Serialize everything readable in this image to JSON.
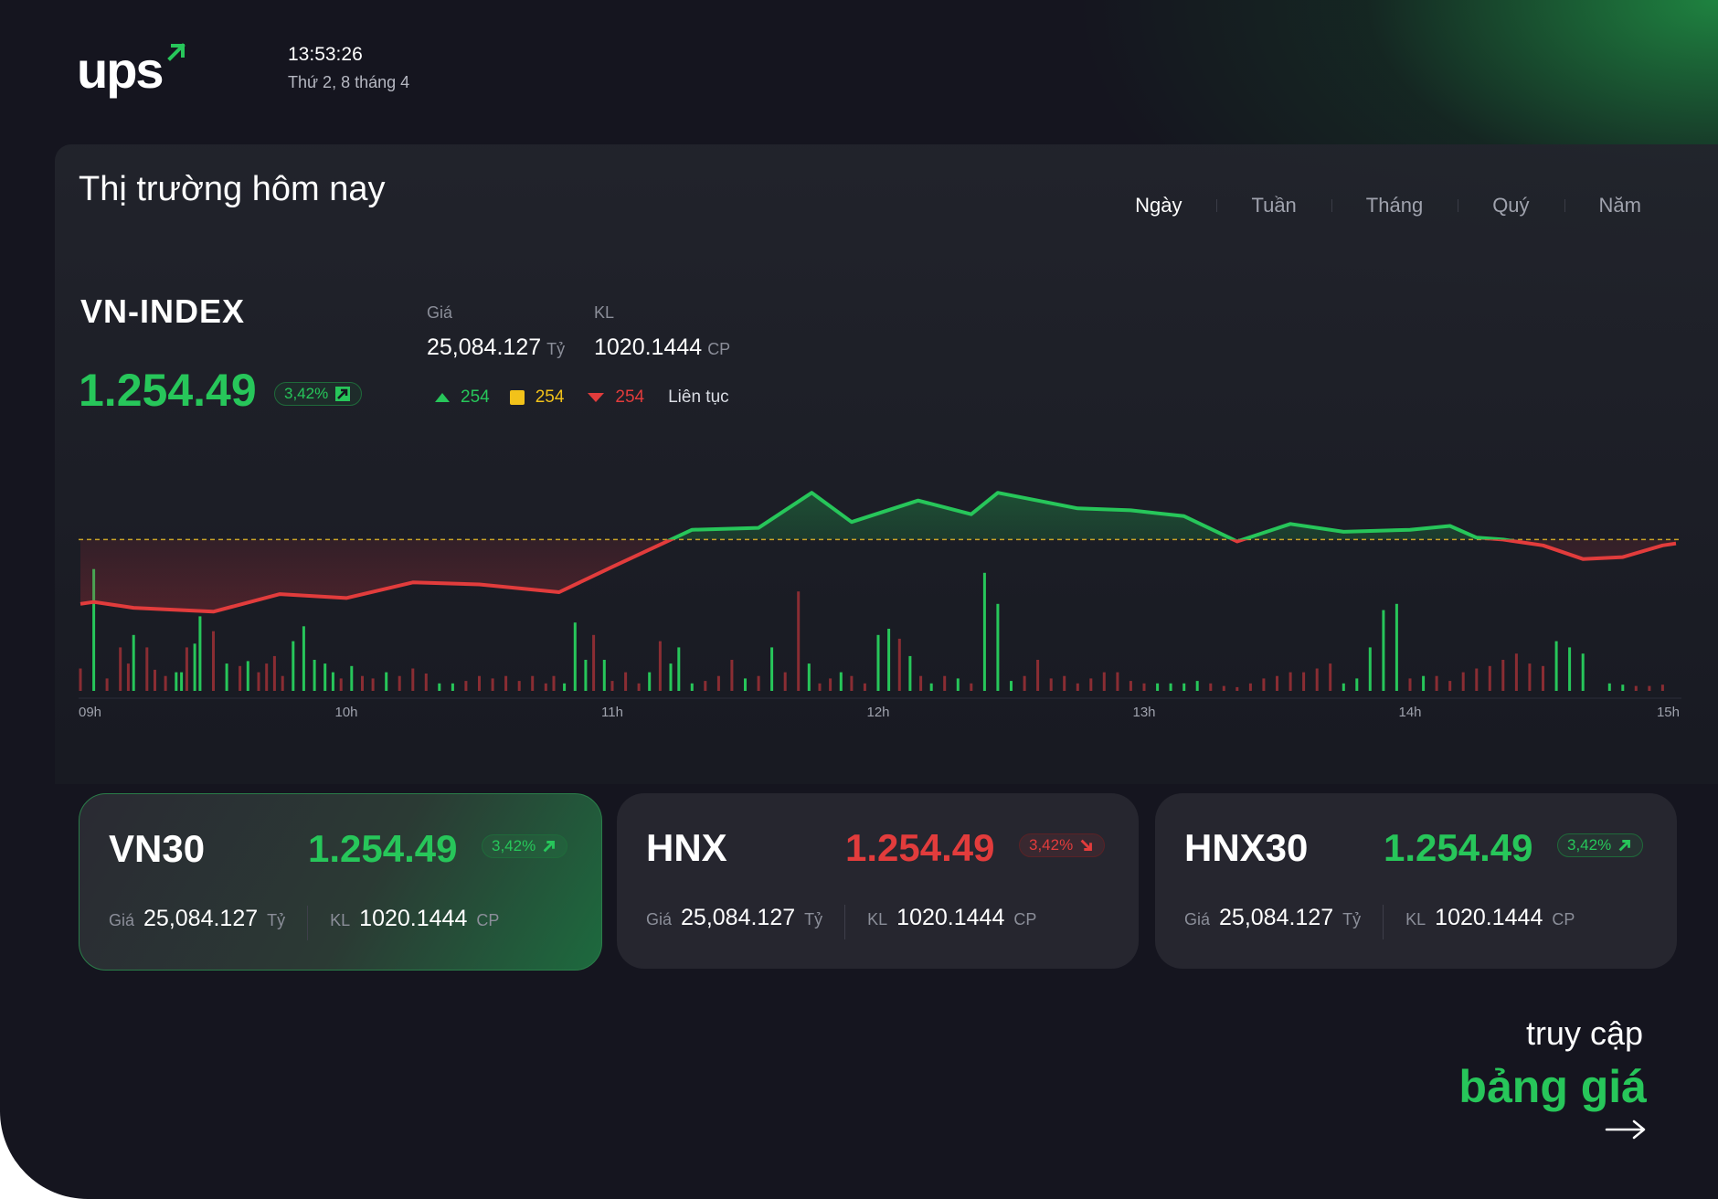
{
  "brand": {
    "logo_text": "ups",
    "accent": "#27c65a"
  },
  "header": {
    "time": "13:53:26",
    "date": "Thứ 2, 8 tháng 4"
  },
  "panel": {
    "title": "Thị trường hôm nay",
    "tabs": [
      "Ngày",
      "Tuần",
      "Tháng",
      "Quý",
      "Năm"
    ],
    "active_tab": "Ngày"
  },
  "vnindex": {
    "name": "VN-INDEX",
    "value": "1.254.49",
    "change": "3,42%",
    "trend": "up",
    "price_label": "Giá",
    "price": "25,084.127",
    "price_unit": "Tỷ",
    "volume_label": "KL",
    "volume": "1020.1444",
    "volume_unit": "CP",
    "advances": "254",
    "unchanged": "254",
    "declines": "254",
    "session": "Liên tục"
  },
  "chart_data": {
    "type": "line",
    "x_ticks": [
      "09h",
      "10h",
      "11h",
      "12h",
      "13h",
      "14h",
      "15h"
    ],
    "x": [
      9.0,
      9.05,
      9.2,
      9.5,
      9.75,
      10.0,
      10.25,
      10.5,
      10.8,
      11.0,
      11.3,
      11.55,
      11.75,
      11.9,
      12.15,
      12.35,
      12.45,
      12.75,
      12.95,
      13.15,
      13.35,
      13.55,
      13.75,
      14.0,
      14.15,
      14.25,
      14.35,
      14.5,
      14.65,
      14.8,
      14.95,
      15.0
    ],
    "values": [
      1249.4,
      1249.5,
      1249.2,
      1249.0,
      1249.9,
      1249.7,
      1250.5,
      1250.4,
      1250.0,
      1251.3,
      1253.2,
      1253.3,
      1255.1,
      1253.6,
      1254.7,
      1254.0,
      1255.1,
      1254.3,
      1254.2,
      1253.9,
      1252.6,
      1253.5,
      1253.1,
      1253.2,
      1253.4,
      1252.8,
      1252.7,
      1252.4,
      1251.7,
      1251.8,
      1252.4,
      1252.5
    ],
    "reference": 1252.7,
    "ylim": [
      1248.5,
      1256.0
    ],
    "volume_bars": [
      {
        "x": 9.0,
        "h": 0.18,
        "c": "down"
      },
      {
        "x": 9.05,
        "h": 0.98,
        "c": "up"
      },
      {
        "x": 9.1,
        "h": 0.1,
        "c": "down"
      },
      {
        "x": 9.15,
        "h": 0.35,
        "c": "down"
      },
      {
        "x": 9.18,
        "h": 0.22,
        "c": "down"
      },
      {
        "x": 9.2,
        "h": 0.45,
        "c": "up"
      },
      {
        "x": 9.25,
        "h": 0.35,
        "c": "down"
      },
      {
        "x": 9.28,
        "h": 0.17,
        "c": "down"
      },
      {
        "x": 9.32,
        "h": 0.12,
        "c": "down"
      },
      {
        "x": 9.36,
        "h": 0.15,
        "c": "up"
      },
      {
        "x": 9.38,
        "h": 0.15,
        "c": "up"
      },
      {
        "x": 9.4,
        "h": 0.35,
        "c": "down"
      },
      {
        "x": 9.43,
        "h": 0.38,
        "c": "up"
      },
      {
        "x": 9.45,
        "h": 0.6,
        "c": "up"
      },
      {
        "x": 9.5,
        "h": 0.48,
        "c": "down"
      },
      {
        "x": 9.55,
        "h": 0.22,
        "c": "up"
      },
      {
        "x": 9.6,
        "h": 0.2,
        "c": "down"
      },
      {
        "x": 9.63,
        "h": 0.24,
        "c": "up"
      },
      {
        "x": 9.67,
        "h": 0.15,
        "c": "down"
      },
      {
        "x": 9.7,
        "h": 0.22,
        "c": "down"
      },
      {
        "x": 9.73,
        "h": 0.28,
        "c": "down"
      },
      {
        "x": 9.76,
        "h": 0.12,
        "c": "down"
      },
      {
        "x": 9.8,
        "h": 0.4,
        "c": "up"
      },
      {
        "x": 9.84,
        "h": 0.52,
        "c": "up"
      },
      {
        "x": 9.88,
        "h": 0.25,
        "c": "up"
      },
      {
        "x": 9.92,
        "h": 0.22,
        "c": "up"
      },
      {
        "x": 9.95,
        "h": 0.15,
        "c": "up"
      },
      {
        "x": 9.98,
        "h": 0.1,
        "c": "down"
      },
      {
        "x": 10.02,
        "h": 0.2,
        "c": "up"
      },
      {
        "x": 10.06,
        "h": 0.12,
        "c": "down"
      },
      {
        "x": 10.1,
        "h": 0.1,
        "c": "down"
      },
      {
        "x": 10.15,
        "h": 0.15,
        "c": "up"
      },
      {
        "x": 10.2,
        "h": 0.12,
        "c": "down"
      },
      {
        "x": 10.25,
        "h": 0.18,
        "c": "down"
      },
      {
        "x": 10.3,
        "h": 0.14,
        "c": "down"
      },
      {
        "x": 10.35,
        "h": 0.06,
        "c": "up"
      },
      {
        "x": 10.4,
        "h": 0.06,
        "c": "up"
      },
      {
        "x": 10.45,
        "h": 0.08,
        "c": "down"
      },
      {
        "x": 10.5,
        "h": 0.12,
        "c": "down"
      },
      {
        "x": 10.55,
        "h": 0.1,
        "c": "down"
      },
      {
        "x": 10.6,
        "h": 0.12,
        "c": "down"
      },
      {
        "x": 10.65,
        "h": 0.08,
        "c": "down"
      },
      {
        "x": 10.7,
        "h": 0.12,
        "c": "down"
      },
      {
        "x": 10.75,
        "h": 0.06,
        "c": "down"
      },
      {
        "x": 10.78,
        "h": 0.12,
        "c": "down"
      },
      {
        "x": 10.82,
        "h": 0.06,
        "c": "up"
      },
      {
        "x": 10.86,
        "h": 0.55,
        "c": "up"
      },
      {
        "x": 10.9,
        "h": 0.25,
        "c": "up"
      },
      {
        "x": 10.93,
        "h": 0.45,
        "c": "down"
      },
      {
        "x": 10.97,
        "h": 0.25,
        "c": "up"
      },
      {
        "x": 11.0,
        "h": 0.08,
        "c": "down"
      },
      {
        "x": 11.05,
        "h": 0.15,
        "c": "down"
      },
      {
        "x": 11.1,
        "h": 0.06,
        "c": "down"
      },
      {
        "x": 11.14,
        "h": 0.15,
        "c": "up"
      },
      {
        "x": 11.18,
        "h": 0.4,
        "c": "down"
      },
      {
        "x": 11.22,
        "h": 0.22,
        "c": "up"
      },
      {
        "x": 11.25,
        "h": 0.35,
        "c": "up"
      },
      {
        "x": 11.3,
        "h": 0.06,
        "c": "up"
      },
      {
        "x": 11.35,
        "h": 0.08,
        "c": "down"
      },
      {
        "x": 11.4,
        "h": 0.12,
        "c": "down"
      },
      {
        "x": 11.45,
        "h": 0.25,
        "c": "down"
      },
      {
        "x": 11.5,
        "h": 0.1,
        "c": "up"
      },
      {
        "x": 11.55,
        "h": 0.12,
        "c": "down"
      },
      {
        "x": 11.6,
        "h": 0.35,
        "c": "up"
      },
      {
        "x": 11.65,
        "h": 0.15,
        "c": "down"
      },
      {
        "x": 11.7,
        "h": 0.8,
        "c": "down"
      },
      {
        "x": 11.74,
        "h": 0.22,
        "c": "up"
      },
      {
        "x": 11.78,
        "h": 0.06,
        "c": "down"
      },
      {
        "x": 11.82,
        "h": 0.1,
        "c": "down"
      },
      {
        "x": 11.86,
        "h": 0.15,
        "c": "up"
      },
      {
        "x": 11.9,
        "h": 0.12,
        "c": "down"
      },
      {
        "x": 11.95,
        "h": 0.06,
        "c": "down"
      },
      {
        "x": 12.0,
        "h": 0.45,
        "c": "up"
      },
      {
        "x": 12.04,
        "h": 0.5,
        "c": "up"
      },
      {
        "x": 12.08,
        "h": 0.42,
        "c": "down"
      },
      {
        "x": 12.12,
        "h": 0.28,
        "c": "up"
      },
      {
        "x": 12.16,
        "h": 0.12,
        "c": "down"
      },
      {
        "x": 12.2,
        "h": 0.06,
        "c": "up"
      },
      {
        "x": 12.25,
        "h": 0.12,
        "c": "down"
      },
      {
        "x": 12.3,
        "h": 0.1,
        "c": "up"
      },
      {
        "x": 12.35,
        "h": 0.06,
        "c": "down"
      },
      {
        "x": 12.4,
        "h": 0.95,
        "c": "up"
      },
      {
        "x": 12.45,
        "h": 0.7,
        "c": "up"
      },
      {
        "x": 12.5,
        "h": 0.08,
        "c": "up"
      },
      {
        "x": 12.55,
        "h": 0.12,
        "c": "down"
      },
      {
        "x": 12.6,
        "h": 0.25,
        "c": "down"
      },
      {
        "x": 12.65,
        "h": 0.1,
        "c": "down"
      },
      {
        "x": 12.7,
        "h": 0.12,
        "c": "down"
      },
      {
        "x": 12.75,
        "h": 0.06,
        "c": "down"
      },
      {
        "x": 12.8,
        "h": 0.1,
        "c": "down"
      },
      {
        "x": 12.85,
        "h": 0.15,
        "c": "down"
      },
      {
        "x": 12.9,
        "h": 0.15,
        "c": "down"
      },
      {
        "x": 12.95,
        "h": 0.08,
        "c": "down"
      },
      {
        "x": 13.0,
        "h": 0.06,
        "c": "down"
      },
      {
        "x": 13.05,
        "h": 0.06,
        "c": "up"
      },
      {
        "x": 13.1,
        "h": 0.06,
        "c": "up"
      },
      {
        "x": 13.15,
        "h": 0.06,
        "c": "up"
      },
      {
        "x": 13.2,
        "h": 0.08,
        "c": "up"
      },
      {
        "x": 13.25,
        "h": 0.06,
        "c": "down"
      },
      {
        "x": 13.3,
        "h": 0.04,
        "c": "down"
      },
      {
        "x": 13.35,
        "h": 0.03,
        "c": "down"
      },
      {
        "x": 13.4,
        "h": 0.06,
        "c": "down"
      },
      {
        "x": 13.45,
        "h": 0.1,
        "c": "down"
      },
      {
        "x": 13.5,
        "h": 0.12,
        "c": "down"
      },
      {
        "x": 13.55,
        "h": 0.15,
        "c": "down"
      },
      {
        "x": 13.6,
        "h": 0.15,
        "c": "down"
      },
      {
        "x": 13.65,
        "h": 0.18,
        "c": "down"
      },
      {
        "x": 13.7,
        "h": 0.22,
        "c": "down"
      },
      {
        "x": 13.75,
        "h": 0.06,
        "c": "up"
      },
      {
        "x": 13.8,
        "h": 0.1,
        "c": "up"
      },
      {
        "x": 13.85,
        "h": 0.35,
        "c": "up"
      },
      {
        "x": 13.9,
        "h": 0.65,
        "c": "up"
      },
      {
        "x": 13.95,
        "h": 0.7,
        "c": "up"
      },
      {
        "x": 14.0,
        "h": 0.1,
        "c": "down"
      },
      {
        "x": 14.05,
        "h": 0.12,
        "c": "up"
      },
      {
        "x": 14.1,
        "h": 0.12,
        "c": "down"
      },
      {
        "x": 14.15,
        "h": 0.08,
        "c": "down"
      },
      {
        "x": 14.2,
        "h": 0.15,
        "c": "down"
      },
      {
        "x": 14.25,
        "h": 0.18,
        "c": "down"
      },
      {
        "x": 14.3,
        "h": 0.2,
        "c": "down"
      },
      {
        "x": 14.35,
        "h": 0.25,
        "c": "down"
      },
      {
        "x": 14.4,
        "h": 0.3,
        "c": "down"
      },
      {
        "x": 14.45,
        "h": 0.22,
        "c": "down"
      },
      {
        "x": 14.5,
        "h": 0.2,
        "c": "down"
      },
      {
        "x": 14.55,
        "h": 0.4,
        "c": "up"
      },
      {
        "x": 14.6,
        "h": 0.35,
        "c": "up"
      },
      {
        "x": 14.65,
        "h": 0.3,
        "c": "up"
      },
      {
        "x": 14.75,
        "h": 0.06,
        "c": "up"
      },
      {
        "x": 14.8,
        "h": 0.05,
        "c": "up"
      },
      {
        "x": 14.85,
        "h": 0.04,
        "c": "down"
      },
      {
        "x": 14.9,
        "h": 0.04,
        "c": "down"
      },
      {
        "x": 14.95,
        "h": 0.05,
        "c": "down"
      }
    ]
  },
  "cards": [
    {
      "name": "VN30",
      "value": "1.254.49",
      "change": "3,42%",
      "trend": "up",
      "highlight": true,
      "price_label": "Giá",
      "price": "25,084.127",
      "price_unit": "Tỷ",
      "volume_label": "KL",
      "volume": "1020.1444",
      "volume_unit": "CP"
    },
    {
      "name": "HNX",
      "value": "1.254.49",
      "change": "3,42%",
      "trend": "down",
      "highlight": false,
      "price_label": "Giá",
      "price": "25,084.127",
      "price_unit": "Tỷ",
      "volume_label": "KL",
      "volume": "1020.1444",
      "volume_unit": "CP"
    },
    {
      "name": "HNX30",
      "value": "1.254.49",
      "change": "3,42%",
      "trend": "up",
      "highlight": false,
      "price_label": "Giá",
      "price": "25,084.127",
      "price_unit": "Tỷ",
      "volume_label": "KL",
      "volume": "1020.1444",
      "volume_unit": "CP"
    }
  ],
  "cta": {
    "line1": "truy cập",
    "line2": "bảng giá",
    "icon": "arrow-right-icon"
  },
  "colors": {
    "up": "#27c65a",
    "down": "#e23c3c",
    "neutral": "#f2c21a",
    "reference_line": "#c9a227"
  }
}
